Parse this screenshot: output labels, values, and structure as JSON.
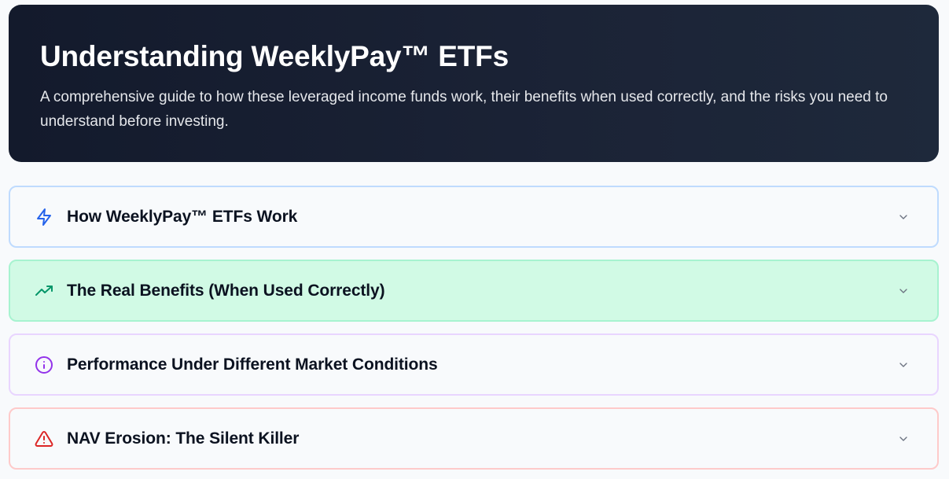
{
  "hero": {
    "title": "Understanding WeeklyPay™ ETFs",
    "subtitle": "A comprehensive guide to how these leveraged income funds work, their benefits when used correctly, and the risks you need to understand before investing."
  },
  "sections": [
    {
      "label": "How WeeklyPay™ ETFs Work",
      "icon": "lightning-bolt-icon",
      "color": "#2563eb"
    },
    {
      "label": "The Real Benefits (When Used Correctly)",
      "icon": "trending-up-icon",
      "color": "#059669"
    },
    {
      "label": "Performance Under Different Market Conditions",
      "icon": "info-circle-icon",
      "color": "#9333ea"
    },
    {
      "label": "NAV Erosion: The Silent Killer",
      "icon": "warning-triangle-icon",
      "color": "#dc2626"
    }
  ],
  "colors": {
    "hero_background": "#1b2336",
    "page_background": "#f8fafc"
  }
}
